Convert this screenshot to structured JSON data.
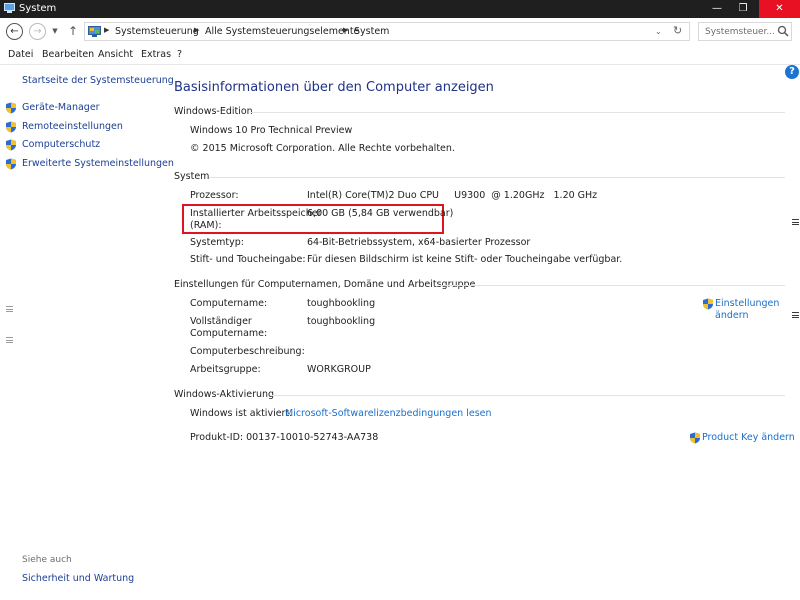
{
  "window": {
    "title": "System",
    "minimize": "—",
    "maximize": "❐",
    "close": "✕"
  },
  "address": {
    "crumbs": [
      "Systemsteuerung",
      "Alle Systemsteuerungselemente",
      "System"
    ],
    "search_placeholder": "Systemsteuer..."
  },
  "menu": {
    "items": [
      "Datei",
      "Bearbeiten",
      "Ansicht",
      "Extras",
      "?"
    ]
  },
  "sidebar": {
    "home_link": "Startseite der Systemsteuerung",
    "items": [
      {
        "label": "Geräte-Manager",
        "icon": "shield-icon"
      },
      {
        "label": "Remoteeinstellungen",
        "icon": "shield-icon"
      },
      {
        "label": "Computerschutz",
        "icon": "shield-icon"
      },
      {
        "label": "Erweiterte Systemeinstellungen",
        "icon": "shield-icon"
      }
    ],
    "see_also_title": "Siehe auch",
    "see_also_link": "Sicherheit und Wartung"
  },
  "main": {
    "heading": "Basisinformationen über den Computer anzeigen",
    "help": "?",
    "edition": {
      "title": "Windows-Edition",
      "name": "Windows 10 Pro Technical Preview",
      "copyright": "© 2015 Microsoft Corporation. Alle Rechte vorbehalten."
    },
    "system": {
      "title": "System",
      "processor_label": "Prozessor:",
      "processor_value": "Intel(R) Core(TM)2 Duo CPU     U9300  @ 1.20GHz   1.20 GHz",
      "ram_label_1": "Installierter Arbeitsspeicher",
      "ram_label_2": "(RAM):",
      "ram_value": "6,00 GB (5,84 GB verwendbar)",
      "systype_label": "Systemtyp:",
      "systype_value": "64-Bit-Betriebssystem, x64-basierter Prozessor",
      "pen_label": "Stift- und Toucheingabe:",
      "pen_value": "Für diesen Bildschirm ist keine Stift- oder Toucheingabe verfügbar."
    },
    "computer": {
      "title": "Einstellungen für Computernamen, Domäne und Arbeitsgruppe",
      "name_label": "Computername:",
      "name_value": "toughbookling",
      "fullname_label_1": "Vollständiger",
      "fullname_label_2": "Computername:",
      "fullname_value": "toughbookling",
      "desc_label": "Computerbeschreibung:",
      "workgroup_label": "Arbeitsgruppe:",
      "workgroup_value": "WORKGROUP",
      "change_link_1": "Einstellungen",
      "change_link_2": "ändern"
    },
    "activation": {
      "title": "Windows-Aktivierung",
      "status": "Windows ist aktiviert.",
      "license_link": "Microsoft-Softwarelizenzbedingungen lesen",
      "product_id": "Produkt-ID: 00137-10010-52743-AA738",
      "product_key_link": "Product Key ändern"
    }
  },
  "colors": {
    "link": "#1c6fc9",
    "heading": "#1e3287",
    "highlight": "#e0141e",
    "titlebar": "#1f1f1f",
    "close": "#e81123"
  }
}
